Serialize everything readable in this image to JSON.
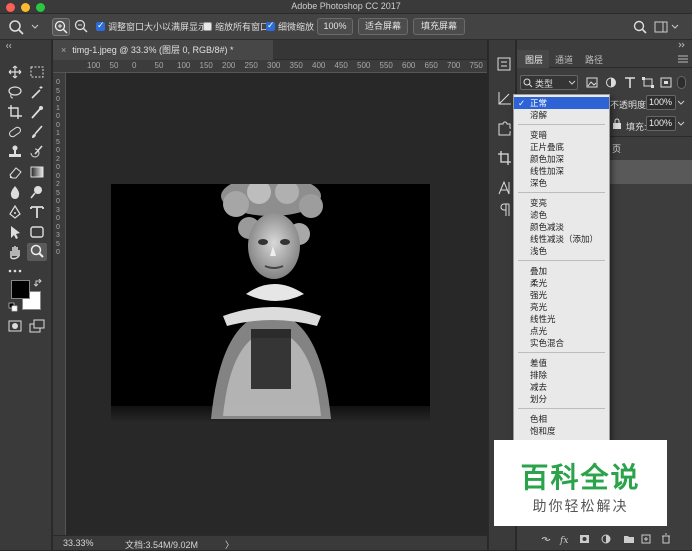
{
  "window": {
    "title": "Adobe Photoshop CC 2017"
  },
  "options_bar": {
    "check_resize_window": "调整窗口大小以满屏显示",
    "check_zoom_all": "缩放所有窗口",
    "check_scrubby": "细微缩放",
    "zoom_value": "100%",
    "fit_screen": "适合屏幕",
    "fill_screen": "填充屏幕"
  },
  "document": {
    "tab_title": "timg-1.jpeg @ 33.3% (图层 0, RGB/8#) *"
  },
  "rulers": {
    "h": [
      "100",
      "50",
      "0",
      "50",
      "100",
      "150",
      "200",
      "250",
      "300",
      "350",
      "400",
      "450",
      "500",
      "550",
      "600",
      "650",
      "700",
      "750"
    ],
    "v": [
      "0",
      "5",
      "0",
      "1",
      "0",
      "0",
      "1",
      "5",
      "0",
      "2",
      "0",
      "0",
      "2",
      "5",
      "0",
      "3",
      "0",
      "0",
      "3",
      "5",
      "0"
    ]
  },
  "status": {
    "zoom": "33.33%",
    "doc_size": "文档:3.54M/9.02M",
    "arrow": "〉"
  },
  "panel": {
    "tabs": [
      "图层",
      "通道",
      "路径"
    ],
    "filter_label": "类型",
    "opacity_label": "不透明度:",
    "opacity_value": "100%",
    "fill_label": "填充:",
    "fill_value": "100%",
    "layer_partial": "页"
  },
  "blend_modes": {
    "groups": [
      [
        "正常",
        "溶解"
      ],
      [
        "变暗",
        "正片叠底",
        "颜色加深",
        "线性加深",
        "深色"
      ],
      [
        "变亮",
        "滤色",
        "颜色减淡",
        "线性减淡（添加）",
        "浅色"
      ],
      [
        "叠加",
        "柔光",
        "强光",
        "亮光",
        "线性光",
        "点光",
        "实色混合"
      ],
      [
        "差值",
        "排除",
        "减去",
        "划分"
      ],
      [
        "色相",
        "饱和度"
      ]
    ],
    "selected": "正常"
  },
  "watermark": {
    "title": "百科全说",
    "subtitle": "助你轻松解决"
  },
  "colors": {
    "accent": "#2e63d6",
    "watermark_green": "#2aa34a"
  }
}
